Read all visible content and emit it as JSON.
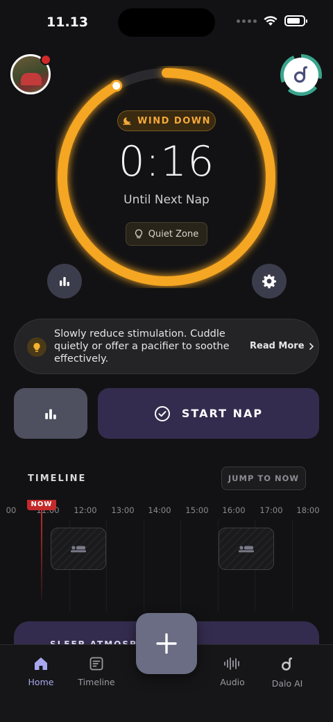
{
  "status_bar": {
    "time": "11.13"
  },
  "header": {
    "profile_has_notification": true
  },
  "timer_card": {
    "phase_label": "WIND DOWN",
    "countdown": "0:16",
    "subtitle": "Until Next Nap",
    "zone_label": "Quiet Zone",
    "progress_fraction": 0.92,
    "accent_color": "#f5a623"
  },
  "tip": {
    "text": "Slowly reduce stimulation. Cuddle quietly or offer a pacifier to soothe effectively.",
    "read_more": "Read More"
  },
  "actions": {
    "start_nap": "START NAP"
  },
  "timeline": {
    "title": "TIMELINE",
    "jump_label": "JUMP TO NOW",
    "now_label": "NOW",
    "ticks": [
      "11:00",
      "12:00",
      "13:00",
      "14:00",
      "15:00",
      "16:00",
      "17:00",
      "18:00"
    ]
  },
  "sleep_card": {
    "label": "SLEEP ATMOSPHERE"
  },
  "nav": {
    "items": [
      {
        "label": "Home",
        "icon": "home-icon",
        "active": true
      },
      {
        "label": "Timeline",
        "icon": "timeline-icon",
        "active": false
      },
      {
        "label": "Audio",
        "icon": "audio-wave-icon",
        "active": false
      },
      {
        "label": "Dalo AI",
        "icon": "dalo-logo-icon",
        "active": false
      }
    ],
    "fab": "add-icon"
  }
}
